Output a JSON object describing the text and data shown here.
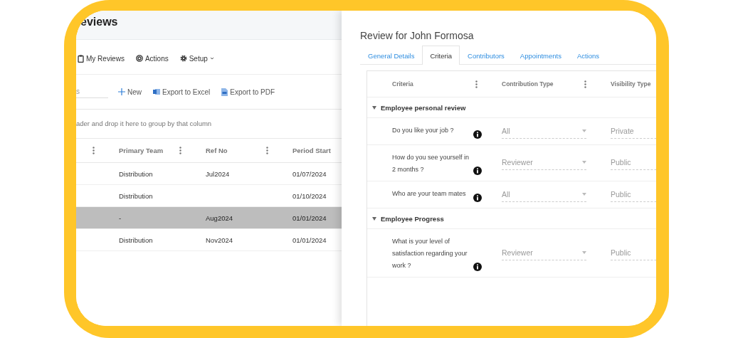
{
  "page": {
    "title": "eviews"
  },
  "menu": [
    {
      "label": "My Reviews",
      "kind": "reviews",
      "has_dropdown": false
    },
    {
      "label": "Actions",
      "kind": "target",
      "has_dropdown": false
    },
    {
      "label": "Setup",
      "kind": "gear",
      "has_dropdown": true
    }
  ],
  "toolbar": {
    "search": {
      "placeholder": "s"
    },
    "buttons": [
      {
        "label": "New",
        "kind": "plus"
      },
      {
        "label": "Export to Excel",
        "kind": "excel"
      },
      {
        "label": "Export to PDF",
        "kind": "pdf"
      }
    ]
  },
  "group_hint": "ader and drop it here to group by that column",
  "table": {
    "columns": [
      "Primary Team",
      "Ref No",
      "Period Start"
    ],
    "rows": [
      {
        "cells": [
          "Distribution",
          "Jul2024",
          "01/07/2024"
        ],
        "selected": false
      },
      {
        "cells": [
          "Distribution",
          null,
          "01/10/2024"
        ],
        "selected": false
      },
      {
        "cells": [
          "-",
          "Aug2024",
          "01/01/2024"
        ],
        "selected": true
      },
      {
        "cells": [
          "Distribution",
          "Nov2024",
          "01/01/2024"
        ],
        "selected": false
      }
    ]
  },
  "drawer": {
    "title": "Review for John Formosa",
    "tabs": [
      {
        "label": "General Details",
        "selected": false
      },
      {
        "label": "Criteria",
        "selected": true
      },
      {
        "label": "Contributors",
        "selected": false
      },
      {
        "label": "Appointments",
        "selected": false
      },
      {
        "label": "Actions",
        "selected": false
      }
    ],
    "grid": {
      "columns": [
        "Criteria",
        "Contribution Type",
        "Visibility Type"
      ],
      "groups": [
        {
          "name": "Employee personal review",
          "expanded": true,
          "rows": [
            {
              "question": "Do you like your job ?",
              "contribution": "All",
              "visibility": "Private"
            },
            {
              "question": "How do you see yourself in 2 months ?",
              "contribution": "Reviewer",
              "visibility": "Public"
            },
            {
              "question": "Who are your team mates",
              "contribution": "All",
              "visibility": "Public"
            }
          ]
        },
        {
          "name": "Employee Progress",
          "expanded": true,
          "rows": [
            {
              "question": "What is your level of satisfaction regarding your work ?",
              "contribution": "Reviewer",
              "visibility": "Public"
            }
          ]
        }
      ]
    }
  }
}
